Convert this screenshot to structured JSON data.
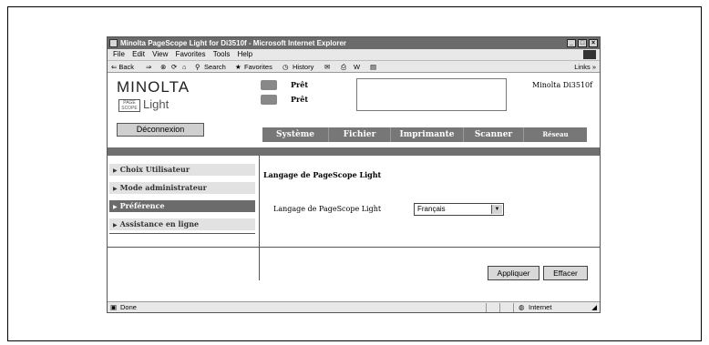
{
  "window": {
    "title": "Minolta PageScope Light for Di3510f - Microsoft Internet Explorer",
    "controls": [
      "_",
      "□",
      "×"
    ]
  },
  "menubar": [
    "File",
    "Edit",
    "View",
    "Favorites",
    "Tools",
    "Help"
  ],
  "toolbar": {
    "back": "⇐ Back",
    "forward": "⇒",
    "search": "Search",
    "favorites": "Favorites",
    "history": "History",
    "links": "Links »"
  },
  "header": {
    "logo": "MINOLTA",
    "product": "Light",
    "product_badge": "PAGE SCOPE",
    "status1": "Prêt",
    "status2": "Prêt",
    "model": "Minolta Di3510f",
    "logout_label": "Déconnexion"
  },
  "nav": {
    "tabs": [
      {
        "label": "Système"
      },
      {
        "label": "Fichier"
      },
      {
        "label": "Imprimante"
      },
      {
        "label": "Scanner"
      },
      {
        "label": "Réseau"
      }
    ]
  },
  "sidebar": {
    "items": [
      {
        "label": "Choix Utilisateur"
      },
      {
        "label": "Mode administrateur"
      },
      {
        "label": "Préférence"
      },
      {
        "label": "Assistance en ligne"
      }
    ]
  },
  "main": {
    "title": "Langage de PageScope Light",
    "language_label": "Langage de PageScope Light",
    "language_value": "Français",
    "apply_label": "Appliquer",
    "clear_label": "Effacer"
  },
  "statusbar": {
    "left": "Done",
    "zone": "Internet"
  },
  "colors": {
    "tab_bg": "#777777",
    "active_menu": "#6b6b6b",
    "titlebar": "#6b6b6b"
  }
}
